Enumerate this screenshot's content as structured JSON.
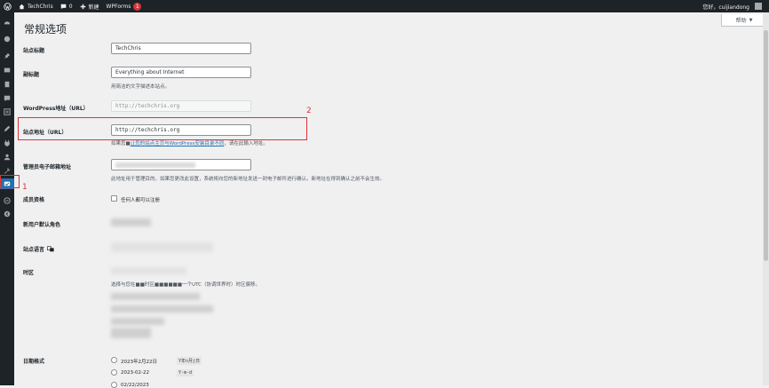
{
  "adminbar": {
    "site_name": "TechChris",
    "comments_count": "0",
    "new_label": "新建",
    "wpforms_label": "WPForms",
    "wpforms_badge": "1",
    "greeting": "您好，cuijiandong"
  },
  "help_tab": {
    "label": "帮助"
  },
  "page_title": "常规选项",
  "fields": {
    "site_title": {
      "label": "站点标题",
      "value": "TechChris"
    },
    "tagline": {
      "label": "副标题",
      "value": "Everything about Internet",
      "desc": "用简洁的文字描述本站点。"
    },
    "wp_url": {
      "label": "WordPress地址（URL）",
      "value": "http://techchris.org"
    },
    "site_url": {
      "label": "站点地址（URL）",
      "value": "http://techchris.org",
      "desc_a": "如果您■",
      "desc_link": "让您的站点主页与WordPress安装目录不同",
      "desc_b": "，请在此输入地址。"
    },
    "admin_email": {
      "label": "管理员电子邮箱地址",
      "desc": "此地址用于管理目的。如果您更改此设置，系统将向您的新地址发送一封电子邮件进行确认。新地址在得到确认之前不会生效。"
    },
    "membership": {
      "label": "成员资格",
      "checkbox": "任何人都可以注册"
    },
    "default_role": {
      "label": "新用户默认角色"
    },
    "site_language": {
      "label": "站点语言"
    },
    "timezone": {
      "label": "时区",
      "desc": "选择与您在■■时区■■■■■■一个UTC（协调世界时）时区偏移。"
    },
    "date_format": {
      "label": "日期格式",
      "options": [
        {
          "label": "2023年2月22日",
          "code": "Y年n月j日"
        },
        {
          "label": "2023-02-22",
          "code": "Y-m-d"
        },
        {
          "label": "02/22/2023",
          "code": "m/d/Y"
        }
      ]
    }
  },
  "annotations": {
    "one": "1",
    "two": "2"
  },
  "colors": {
    "accent": "#2271b1",
    "adminbar": "#1d2327",
    "annotation": "#e03131",
    "badge": "#d63638"
  }
}
